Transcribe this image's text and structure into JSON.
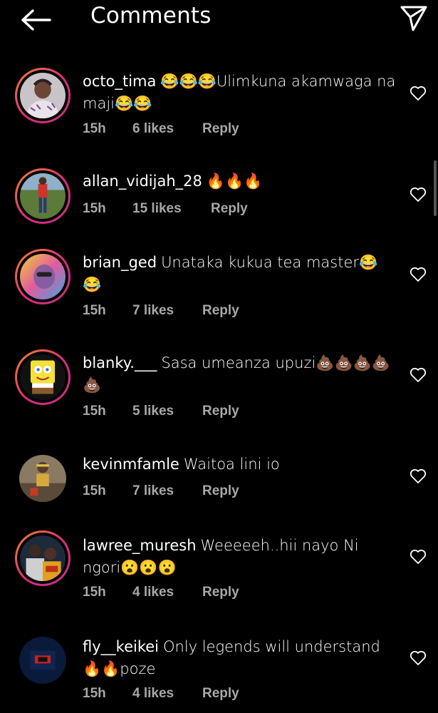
{
  "header": {
    "title": "Comments",
    "back_icon": "back-arrow-icon",
    "share_icon": "send-icon"
  },
  "comments": [
    {
      "username": "octo_tima",
      "text": "😂😂😂Ulimkuna akamwaga na maji😂😂",
      "time": "15h",
      "likes": "6 likes",
      "reply": "Reply",
      "has_story_ring": true
    },
    {
      "username": "allan_vidijah_28",
      "text": "🔥🔥🔥",
      "time": "15h",
      "likes": "15 likes",
      "reply": "Reply",
      "has_story_ring": true
    },
    {
      "username": "brian_ged",
      "text": "Unataka kukua tea master😂😂",
      "time": "15h",
      "likes": "7 likes",
      "reply": "Reply",
      "has_story_ring": true
    },
    {
      "username": "blanky.___",
      "text": "Sasa umeanza upuzi💩💩💩💩💩",
      "time": "15h",
      "likes": "5 likes",
      "reply": "Reply",
      "has_story_ring": true
    },
    {
      "username": "kevinmfamle",
      "text": "Waitoa lini io",
      "time": "15h",
      "likes": "7 likes",
      "reply": "Reply",
      "has_story_ring": false
    },
    {
      "username": "lawree_muresh",
      "text": "Weeeeeh..hii nayo Ni ngori😮😮😮",
      "time": "15h",
      "likes": "4 likes",
      "reply": "Reply",
      "has_story_ring": true
    },
    {
      "username": "fly__keikei",
      "text": "Only legends will understand 🔥🔥poze",
      "time": "15h",
      "likes": "4 likes",
      "reply": "Reply",
      "has_story_ring": false
    }
  ],
  "colors": {
    "background": "#000000",
    "text": "#ffffff",
    "meta": "#a8a8a8",
    "ring_start": "#f58529",
    "ring_end": "#c13584"
  }
}
